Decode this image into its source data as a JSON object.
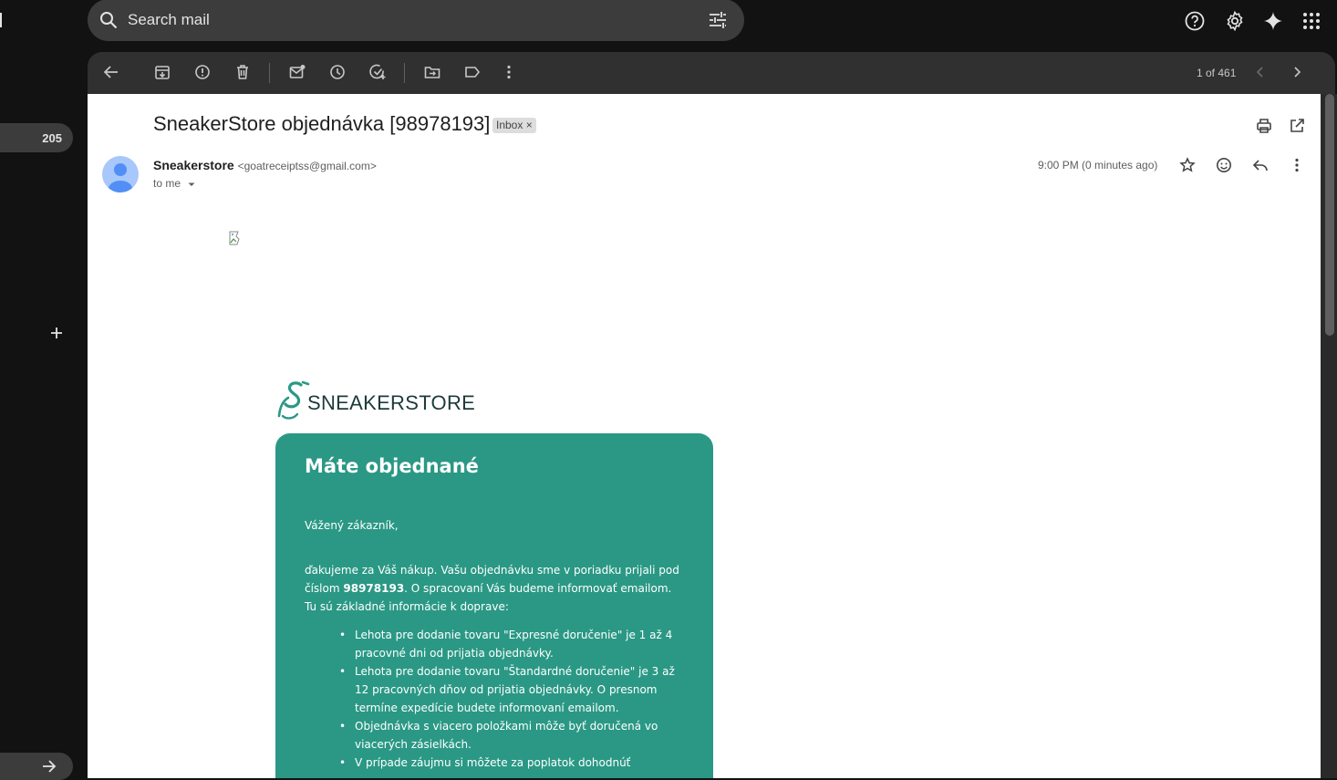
{
  "search": {
    "placeholder": "Search mail"
  },
  "rail": {
    "badge_count": "205"
  },
  "toolbar": {
    "page_counter": "1 of 461"
  },
  "email": {
    "subject": "SneakerStore objednávka [98978193]",
    "label_chip": "Inbox",
    "label_chip_close": "×",
    "sender_name": "Sneakerstore",
    "sender_email": "<goatreceiptss@gmail.com>",
    "to": "to me",
    "timestamp": "9:00 PM (0 minutes ago)"
  },
  "body": {
    "brand_name": "SNEAKERSTORE",
    "card_title": "Máte objednané",
    "greeting": "Vážený zákazník,",
    "para_before": "ďakujeme za Váš nákup. Vašu objednávku sme v poriadku prijali pod číslom ",
    "order_number": "98978193",
    "para_after": ". O spracovaní Vás budeme informovať emailom. Tu sú základné informácie k doprave:",
    "bullets": [
      "Lehota pre dodanie tovaru \"Expresné doručenie\" je 1 až 4 pracovné dni od prijatia objednávky.",
      "Lehota pre dodanie tovaru \"Štandardné doručenie\" je 3 až 12 pracovných dňov od prijatia objednávky. O presnom termíne expedície budete informovaní emailom.",
      "Objednávka s viacero položkami môže byť doručená vo viacerých zásielkách.",
      "V prípade záujmu si môžete za poplatok dohodnúť"
    ]
  },
  "colors": {
    "card": "#2a9885",
    "brand": "#2a9885",
    "surface": "#303030",
    "background": "#121212"
  },
  "icons": [
    "search-icon",
    "filter-icon",
    "help-icon",
    "settings-icon",
    "gemini-icon",
    "apps-icon",
    "back-icon",
    "archive-icon",
    "report-spam-icon",
    "delete-icon",
    "mark-unread-icon",
    "snooze-icon",
    "add-task-icon",
    "move-to-icon",
    "label-icon",
    "more-icon",
    "prev-icon",
    "next-icon",
    "print-icon",
    "open-new-window-icon",
    "star-icon",
    "emoji-icon",
    "reply-icon",
    "plus-icon",
    "arrow-right-icon"
  ]
}
